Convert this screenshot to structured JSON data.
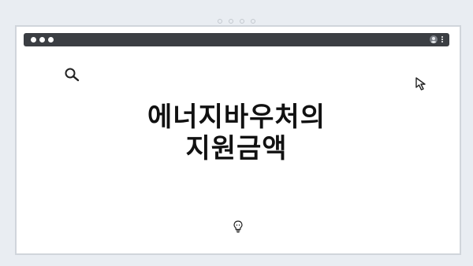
{
  "page": {
    "headline_line1": "에너지바우처의",
    "headline_line2": "지원금액"
  },
  "icons": {
    "search": "search-icon",
    "cursor": "cursor-icon",
    "lightbulb": "lightbulb-icon",
    "profile": "profile-icon",
    "menu": "kebab-menu-icon"
  },
  "colors": {
    "background": "#e9edf2",
    "titlebar": "#3b3e43",
    "canvas": "#ffffff",
    "text": "#111111"
  }
}
